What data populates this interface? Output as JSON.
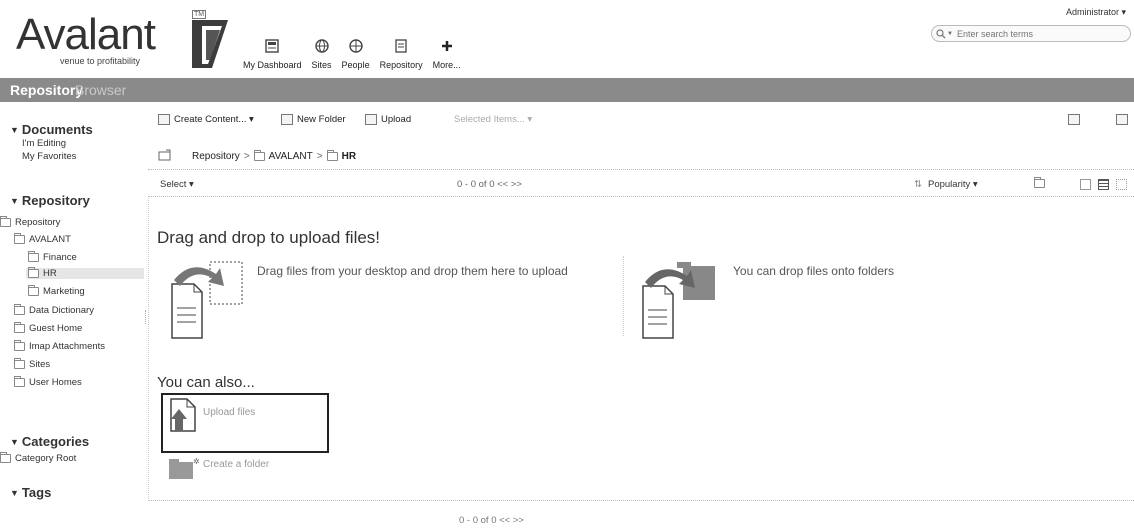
{
  "header": {
    "logo_word": "Avalant",
    "logo_tagline": "venue to profitability",
    "logo_tm": "TM",
    "nav": [
      {
        "label": "My Dashboard",
        "icon": "dashboard-icon"
      },
      {
        "label": "Sites",
        "icon": "sites-icon"
      },
      {
        "label": "People",
        "icon": "people-icon"
      },
      {
        "label": "Repository",
        "icon": "repository-icon"
      },
      {
        "label": "More...",
        "icon": "plus-icon"
      }
    ],
    "user_menu": "Administrator ▾",
    "search_placeholder": "Enter search terms"
  },
  "titlebar": {
    "primary": "Repository",
    "secondary": "Browser"
  },
  "sidebar": {
    "documents_head": "Documents",
    "documents_items": [
      "I'm Editing",
      "My Favorites"
    ],
    "repository_head": "Repository",
    "tree": [
      {
        "label": "Repository",
        "level": 0
      },
      {
        "label": "AVALANT",
        "level": 1
      },
      {
        "label": "Finance",
        "level": 2
      },
      {
        "label": "HR",
        "level": 2,
        "selected": true
      },
      {
        "label": "Marketing",
        "level": 2
      },
      {
        "label": "Data Dictionary",
        "level": 1
      },
      {
        "label": "Guest Home",
        "level": 1
      },
      {
        "label": "Imap Attachments",
        "level": 1
      },
      {
        "label": "Sites",
        "level": 1
      },
      {
        "label": "User Homes",
        "level": 1
      }
    ],
    "categories_head": "Categories",
    "categories_items": [
      "Category Root"
    ],
    "tags_head": "Tags"
  },
  "toolbar": {
    "create_content": "Create Content... ▾",
    "new_folder": "New Folder",
    "upload": "Upload",
    "selected_items": "Selected Items... ▾"
  },
  "breadcrumb": {
    "items": [
      "Repository",
      "AVALANT",
      "HR"
    ],
    "sep": ">"
  },
  "filterbar": {
    "select": "Select ▾",
    "pager": "0 - 0 of 0   <<   >>",
    "sort": "Popularity ▾"
  },
  "main": {
    "dd_title": "Drag and drop to upload files!",
    "dd_text_1": "Drag files from your desktop and drop them here to upload",
    "dd_text_2": "You can drop files onto folders",
    "also_title": "You can also...",
    "option_upload": "Upload files",
    "option_folder": "Create a folder"
  },
  "pager_bottom": "0 - 0 of 0   <<   >>",
  "colors": {
    "titlebar": "#8a8a8a",
    "accent": "#444444"
  }
}
